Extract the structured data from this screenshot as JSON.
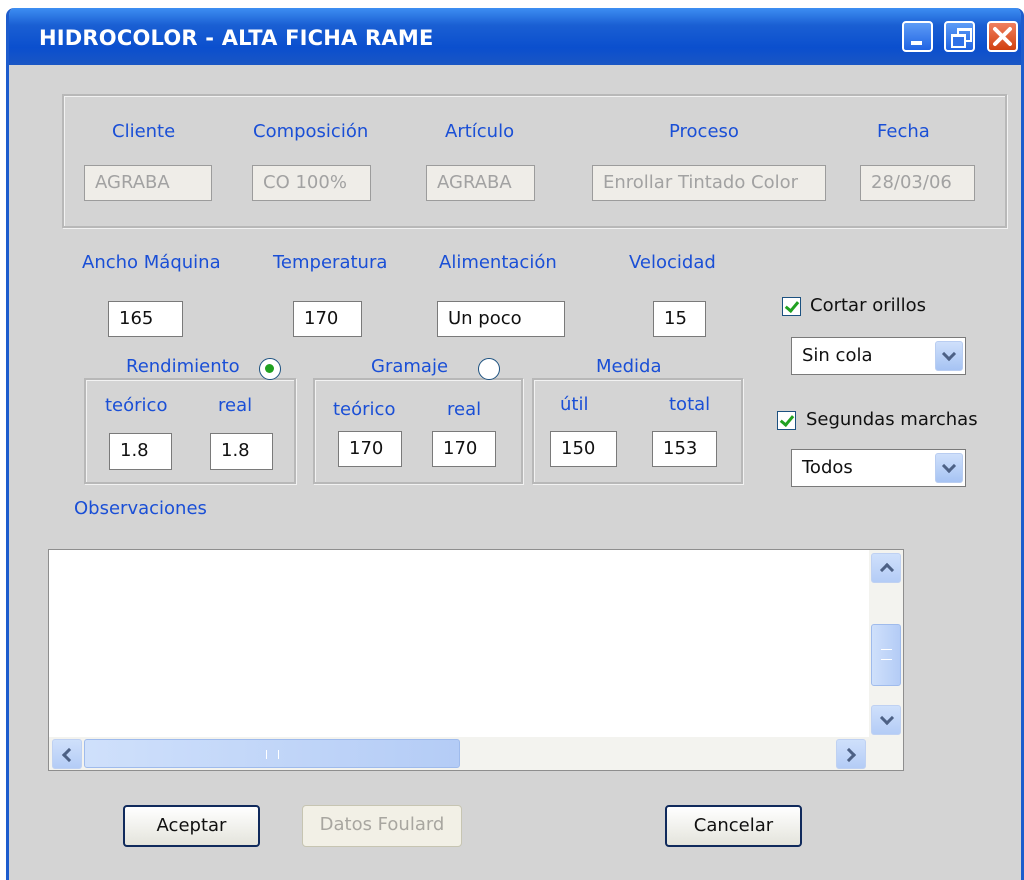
{
  "window": {
    "title": "HIDROCOLOR - ALTA FICHA RAME"
  },
  "header_group": {
    "fields": [
      {
        "label": "Cliente",
        "value": "AGRABA"
      },
      {
        "label": "Composición",
        "value": "CO 100%"
      },
      {
        "label": "Artículo",
        "value": "AGRABA"
      },
      {
        "label": "Proceso",
        "value": "Enrollar Tintado Color"
      },
      {
        "label": "Fecha",
        "value": "28/03/06"
      }
    ]
  },
  "machine": {
    "ancho": {
      "label": "Ancho Máquina",
      "value": "165"
    },
    "temperatura": {
      "label": "Temperatura",
      "value": "170"
    },
    "alimentacion": {
      "label": "Alimentación",
      "value": "Un poco"
    },
    "velocidad": {
      "label": "Velocidad",
      "value": "15"
    }
  },
  "rendimiento": {
    "label": "Rendimiento",
    "selected": true,
    "teorico_label": "teórico",
    "real_label": "real",
    "teorico": "1.8",
    "real": "1.8"
  },
  "gramaje": {
    "label": "Gramaje",
    "selected": false,
    "teorico_label": "teórico",
    "real_label": "real",
    "teorico": "170",
    "real": "170"
  },
  "medida": {
    "label": "Medida",
    "util_label": "útil",
    "total_label": "total",
    "util": "150",
    "total": "153"
  },
  "options": {
    "cortar_orillos": {
      "label": "Cortar orillos",
      "checked": true
    },
    "cola_select": {
      "value": "Sin cola"
    },
    "segundas_marchas": {
      "label": "Segundas marchas",
      "checked": true
    },
    "marchas_select": {
      "value": "Todos"
    }
  },
  "observaciones": {
    "label": "Observaciones",
    "value": ""
  },
  "buttons": {
    "aceptar": "Aceptar",
    "datos_foulard": "Datos Foulard",
    "cancelar": "Cancelar"
  }
}
